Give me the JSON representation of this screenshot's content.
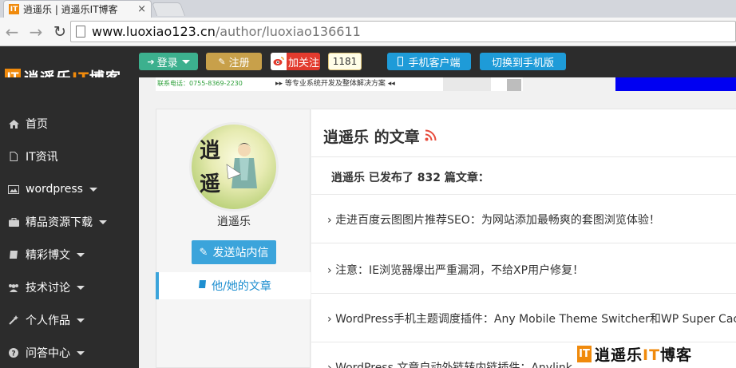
{
  "browser": {
    "tab_title": "逍遥乐 | 逍遥乐IT博客",
    "favicon_text": "IT",
    "url_host": "www.luoxiao123.cn",
    "url_path": "/author/luoxiao136611"
  },
  "site": {
    "logo_mark": "IT",
    "logo_pre": "逍遥乐",
    "logo_it": "IT",
    "logo_post": "博客",
    "login_label": "登录",
    "register_label": "注册",
    "weibo_follow_label": "加关注",
    "weibo_count": "1181",
    "app_label": "手机客户端",
    "mobile_label": "切换到手机版"
  },
  "banner": {
    "phone": "联系电话：0755-8369-2230",
    "text": "▸▸ 等专业系统开发及整体解决方案 ◂◂"
  },
  "sidebar": {
    "items": [
      {
        "label": "首页"
      },
      {
        "label": "IT资讯"
      },
      {
        "label": "wordpress"
      },
      {
        "label": "精品资源下载"
      },
      {
        "label": "精彩博文"
      },
      {
        "label": "技术讨论"
      },
      {
        "label": "个人作品"
      },
      {
        "label": "问答中心"
      }
    ]
  },
  "profile": {
    "avatar_chars": [
      "逍",
      "遥"
    ],
    "name": "逍遥乐",
    "message_button": "发送站内信",
    "his_articles": "他/她的文章"
  },
  "main": {
    "title": "逍遥乐 的文章",
    "count_line": "逍遥乐 已发布了 832 篇文章：",
    "articles": [
      "走进百度云图图片推荐SEO：为网站添加最畅爽的套图浏览体验！",
      "注意：IE浏览器爆出严重漏洞，不给XP用户修复！",
      "WordPress手机主题调度插件：Any Mobile Theme Switcher和WP Super Cache",
      "WordPress 文章自动外链转内链插件：Anylink"
    ]
  },
  "footer": {
    "logo_mark": "IT",
    "logo_pre": "逍遥乐",
    "logo_it": "IT",
    "logo_post": "博客"
  },
  "colors": {
    "accent": "#f08a0c",
    "login_green": "#3cb08e",
    "register_gold": "#c8a04a",
    "primary_blue": "#1e9bd8",
    "sidebar_bg": "#2c2c2c"
  }
}
